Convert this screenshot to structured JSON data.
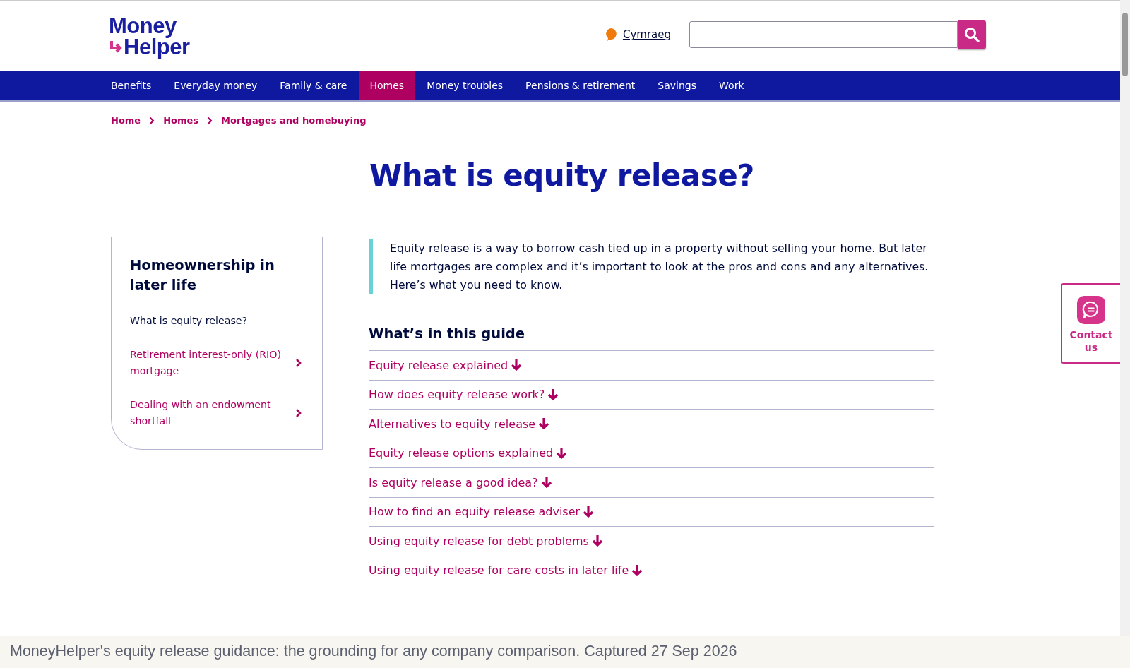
{
  "logo": {
    "line_1": "Money",
    "line_2": "Helper"
  },
  "language_link": "Cymraeg",
  "nav": [
    {
      "label": "Benefits",
      "selected": false
    },
    {
      "label": "Everyday money",
      "selected": false
    },
    {
      "label": "Family & care",
      "selected": false
    },
    {
      "label": "Homes",
      "selected": true
    },
    {
      "label": "Money troubles",
      "selected": false
    },
    {
      "label": "Pensions & retirement",
      "selected": false
    },
    {
      "label": "Savings",
      "selected": false
    },
    {
      "label": "Work",
      "selected": false
    }
  ],
  "breadcrumb": [
    "Home",
    "Homes",
    "Mortgages and homebuying"
  ],
  "title": "What is equity release?",
  "sidebar": {
    "title": "Homeownership in later life",
    "items": [
      {
        "label": "What is equity release?",
        "selected": true
      },
      {
        "label": "Retirement interest-only (RIO) mortgage",
        "selected": false
      },
      {
        "label": "Dealing with an endowment shortfall",
        "selected": false
      }
    ]
  },
  "intro": "Equity release is a way to borrow cash tied up in a property without selling your home. But later life mortgages are complex and it’s important to look at the pros and cons and any alternatives. Here’s what you need to know.",
  "guide": {
    "heading": "What’s in this guide",
    "links": [
      "Equity release explained",
      "How does equity release work?",
      "Alternatives to equity release",
      "Equity release options explained",
      "Is equity release a good idea?",
      "How to find an equity release adviser",
      "Using equity release for debt problems",
      "Using equity release for care costs in later life"
    ]
  },
  "contact": {
    "label": "Contact us"
  },
  "caption": "MoneyHelper's equity release guidance: the grounding for any company comparison. Captured 27 Sep 2026"
}
